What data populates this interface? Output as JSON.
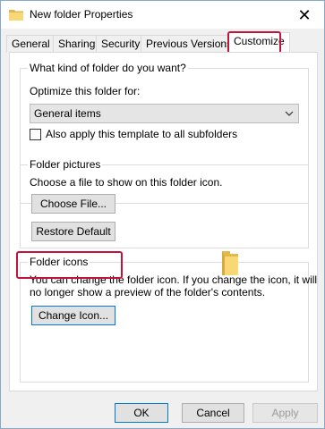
{
  "window": {
    "title": "New folder Properties",
    "close_glyph": "✕",
    "title_icon": "folder-icon"
  },
  "tabs": [
    {
      "label": "General",
      "active": false
    },
    {
      "label": "Sharing",
      "active": false
    },
    {
      "label": "Security",
      "active": false
    },
    {
      "label": "Previous Versions",
      "active": false
    },
    {
      "label": "Customize",
      "active": true
    }
  ],
  "folder_type": {
    "title": "What kind of folder do you want?",
    "optimize_label": "Optimize this folder for:",
    "selected": "General items",
    "apply_subfolders_label": "Also apply this template to all subfolders",
    "apply_subfolders_checked": false
  },
  "folder_pictures": {
    "title": "Folder pictures",
    "description": "Choose a file to show on this folder icon.",
    "choose_file_label": "Choose File...",
    "restore_default_label": "Restore Default"
  },
  "folder_icons": {
    "title": "Folder icons",
    "description_line1": "You can change the folder icon. If you change the icon, it will",
    "description_line2": "no longer show a preview of the folder's contents.",
    "change_icon_label": "Change Icon..."
  },
  "footer": {
    "ok_label": "OK",
    "cancel_label": "Cancel",
    "apply_label": "Apply",
    "apply_enabled": false
  },
  "colors": {
    "highlight": "#c0143c",
    "primary_border": "#0078d7",
    "folder_yellow": "#f8d775"
  }
}
